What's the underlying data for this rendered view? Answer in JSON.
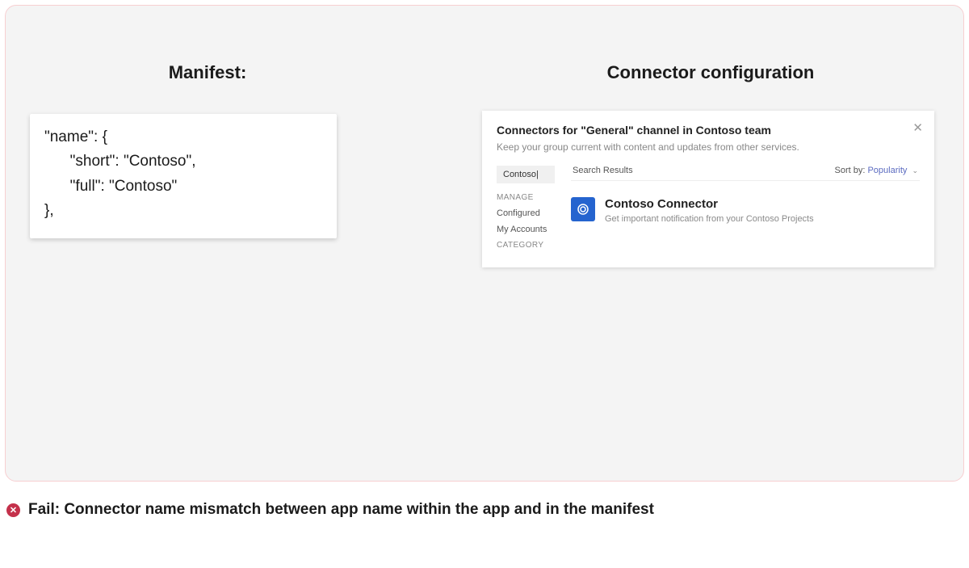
{
  "left": {
    "title": "Manifest:",
    "code": "\"name\": {\n      \"short\": \"Contoso\",\n      \"full\": \"Contoso\"\n},"
  },
  "right": {
    "title": "Connector configuration",
    "dialog_title": "Connectors for \"General\" channel in Contoso team",
    "dialog_sub": "Keep your group current with content and updates from other services.",
    "search_value": "Contoso|",
    "sidebar": {
      "manage_label": "MANAGE",
      "configured": "Configured",
      "my_accounts": "My Accounts",
      "category_label": "CATEGORY"
    },
    "results_label": "Search Results",
    "sortby_label": "Sort by:",
    "sortby_value": "Popularity",
    "app_name": "Contoso Connector",
    "app_desc": "Get important notification from your Contoso Projects"
  },
  "fail_text": "Fail: Connector name mismatch between app name within the app and in the manifest"
}
